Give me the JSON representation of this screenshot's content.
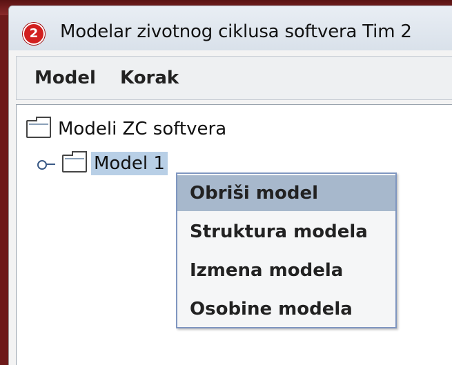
{
  "window": {
    "title": "Modelar zivotnog ciklusa softvera Tim 2",
    "app_icon_text": "2"
  },
  "menubar": {
    "items": [
      {
        "label": "Model"
      },
      {
        "label": "Korak"
      }
    ]
  },
  "tree": {
    "root_label": "Modeli ZC softvera",
    "child_label": "Model 1"
  },
  "context_menu": {
    "items": [
      {
        "label": "Obriši model",
        "highlighted": true
      },
      {
        "label": "Struktura modela"
      },
      {
        "label": "Izmena modela"
      },
      {
        "label": "Osobine modela"
      }
    ]
  },
  "colors": {
    "selection": "#b8cfe6",
    "menu_highlight": "#a7b8cc",
    "app_icon": "#d21f1f"
  }
}
